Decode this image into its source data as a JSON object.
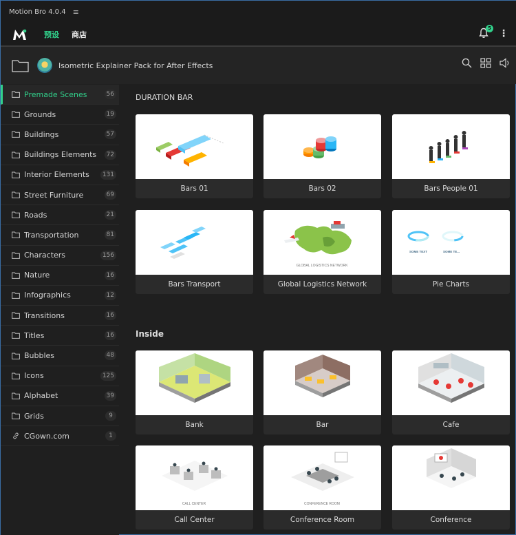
{
  "app": {
    "title": "Motion Bro 4.0.4",
    "menu_icon": "hamburger-icon"
  },
  "topbar": {
    "tabs": [
      {
        "label": "预设",
        "active": true
      },
      {
        "label": "商店",
        "active": false
      }
    ],
    "notifications": "5"
  },
  "pack": {
    "title": "Isometric Explainer Pack for After Effects"
  },
  "sidebar": {
    "items": [
      {
        "label": "Premade Scenes",
        "count": "56",
        "active": true
      },
      {
        "label": "Grounds",
        "count": "19"
      },
      {
        "label": "Buildings",
        "count": "57"
      },
      {
        "label": "Buildings Elements",
        "count": "72"
      },
      {
        "label": "Interior Elements",
        "count": "131"
      },
      {
        "label": "Street Furniture",
        "count": "69"
      },
      {
        "label": "Roads",
        "count": "21"
      },
      {
        "label": "Transportation",
        "count": "81"
      },
      {
        "label": "Characters",
        "count": "156"
      },
      {
        "label": "Nature",
        "count": "16"
      },
      {
        "label": "Infographics",
        "count": "12"
      },
      {
        "label": "Transitions",
        "count": "16"
      },
      {
        "label": "Titles",
        "count": "16"
      },
      {
        "label": "Bubbles",
        "count": "48"
      },
      {
        "label": "Icons",
        "count": "125"
      },
      {
        "label": "Alphabet",
        "count": "39"
      },
      {
        "label": "Grids",
        "count": "9"
      },
      {
        "label": "CGown.com",
        "count": "1",
        "icon": "link-icon"
      }
    ]
  },
  "sections": [
    {
      "title": "DURATION BAR",
      "cards": [
        {
          "label": "Bars 01"
        },
        {
          "label": "Bars 02"
        },
        {
          "label": "Bars People 01"
        },
        {
          "label": "Bars Transport"
        },
        {
          "label": "Global Logistics Network",
          "thumb_caption": "GLOBAL LOGISTICS NETWORK"
        },
        {
          "label": "Pie Charts",
          "thumb_captions": [
            "SOME TEXT",
            "SOME TE..."
          ]
        }
      ]
    },
    {
      "title": "Inside",
      "cards": [
        {
          "label": "Bank"
        },
        {
          "label": "Bar"
        },
        {
          "label": "Cafe"
        },
        {
          "label": "Call Center",
          "thumb_caption": "CALL CENTER"
        },
        {
          "label": "Conference Room",
          "thumb_caption": "CONFERENCE ROOM"
        },
        {
          "label": "Conference"
        }
      ]
    }
  ],
  "colors": {
    "accent": "#31d18b",
    "background": "#1f1f1f",
    "card": "#2b2b2b"
  }
}
